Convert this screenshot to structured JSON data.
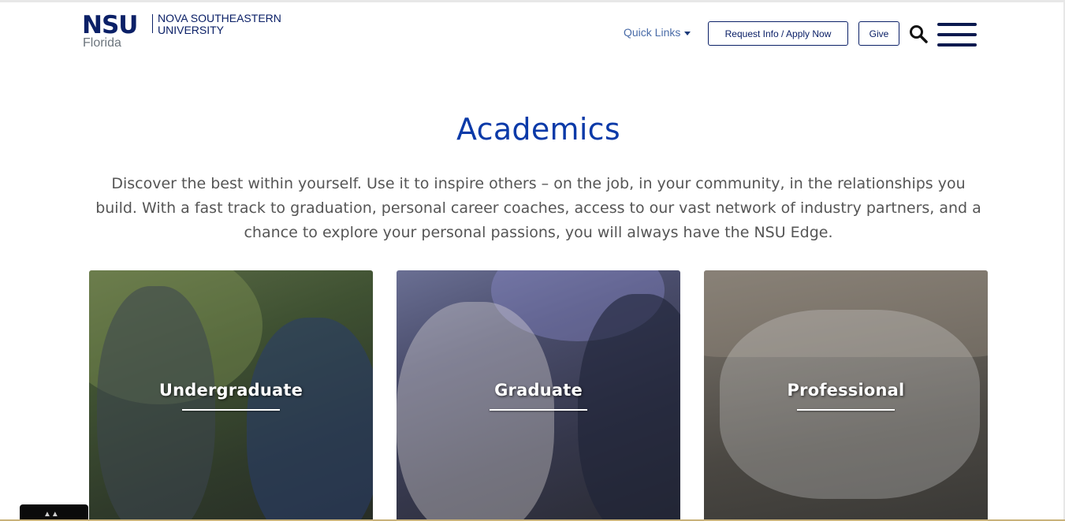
{
  "header": {
    "logo": {
      "abbr": "NSU",
      "location": "Florida",
      "name": "NOVA SOUTHEASTERN UNIVERSITY"
    },
    "quick_links_label": "Quick Links",
    "request_label": "Request Info / Apply Now",
    "give_label": "Give",
    "search_icon": "search-icon",
    "menu_icon": "hamburger-menu-icon"
  },
  "main": {
    "title": "Academics",
    "intro": "Discover the best within yourself. Use it to inspire others – on the job, in your community, in the relationships you build. With a fast track to graduation, personal career coaches, access to our vast network of industry partners, and a chance to explore your personal passions, you will always have the NSU Edge.",
    "cards": [
      {
        "label": "Undergraduate"
      },
      {
        "label": "Graduate"
      },
      {
        "label": "Professional"
      }
    ]
  },
  "colors": {
    "brand_navy": "#0b2067",
    "heading_blue": "#0b3aa8",
    "body_text": "#555555",
    "link_blue": "#4a6ca8"
  }
}
